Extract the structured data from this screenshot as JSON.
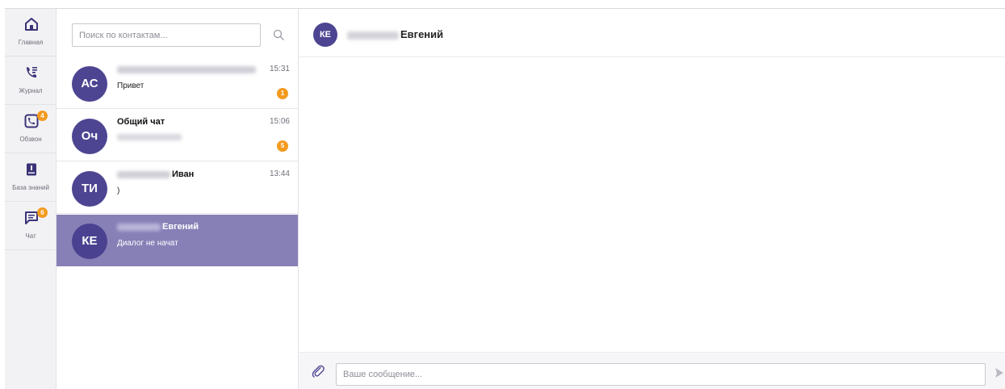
{
  "nav": {
    "items": [
      {
        "label": "Главная",
        "icon": "home-icon",
        "badge": null
      },
      {
        "label": "Журнал",
        "icon": "phone-log-icon",
        "badge": null
      },
      {
        "label": "Обзвон",
        "icon": "dialer-icon",
        "badge": "4"
      },
      {
        "label": "База знаний",
        "icon": "knowledge-base-icon",
        "badge": null
      },
      {
        "label": "Чат",
        "icon": "chat-icon",
        "badge": "6"
      }
    ]
  },
  "contacts": {
    "search_placeholder": "Поиск по контактам...",
    "items": [
      {
        "initials": "АС",
        "name": "",
        "last_message": "Привет",
        "time": "15:31",
        "unread": "1"
      },
      {
        "initials": "Оч",
        "name": "Общий чат",
        "last_message": "",
        "time": "15:06",
        "unread": "5"
      },
      {
        "initials": "ТИ",
        "name": "Иван",
        "last_message": ")",
        "time": "13:44",
        "unread": null
      },
      {
        "initials": "КЕ",
        "name": "Евгений",
        "last_message": "Диалог не начат",
        "time": "",
        "unread": null
      }
    ]
  },
  "chat": {
    "initials": "КЕ",
    "title": "Евгений",
    "input_placeholder": "Ваше сообщение..."
  },
  "colors": {
    "accent": "#4d4592",
    "active_row": "#8680b7",
    "badge": "#f39a1e"
  }
}
